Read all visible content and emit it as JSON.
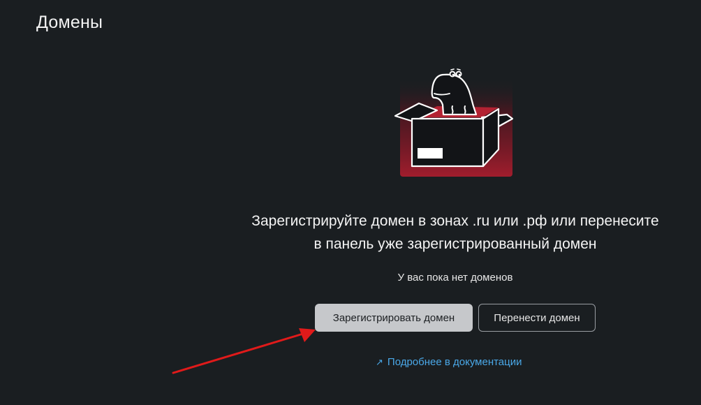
{
  "page": {
    "title": "Домены"
  },
  "empty_state": {
    "headline_line1": "Зарегистрируйте домен в зонах .ru или .рф или перенесите",
    "headline_line2": "в панель уже зарегистрированный домен",
    "note": "У вас пока нет доменов"
  },
  "actions": {
    "register_label": "Зарегистрировать домен",
    "transfer_label": "Перенести домен"
  },
  "docs_link": {
    "label": "Подробнее в документации",
    "icon": "external-link-arrow-icon"
  },
  "colors": {
    "background": "#1a1e21",
    "link": "#4aa8e8",
    "primary_button": "#c6c8cb",
    "illustration_accent": "#9e1d2c",
    "annotation_arrow": "#e01a1a"
  }
}
